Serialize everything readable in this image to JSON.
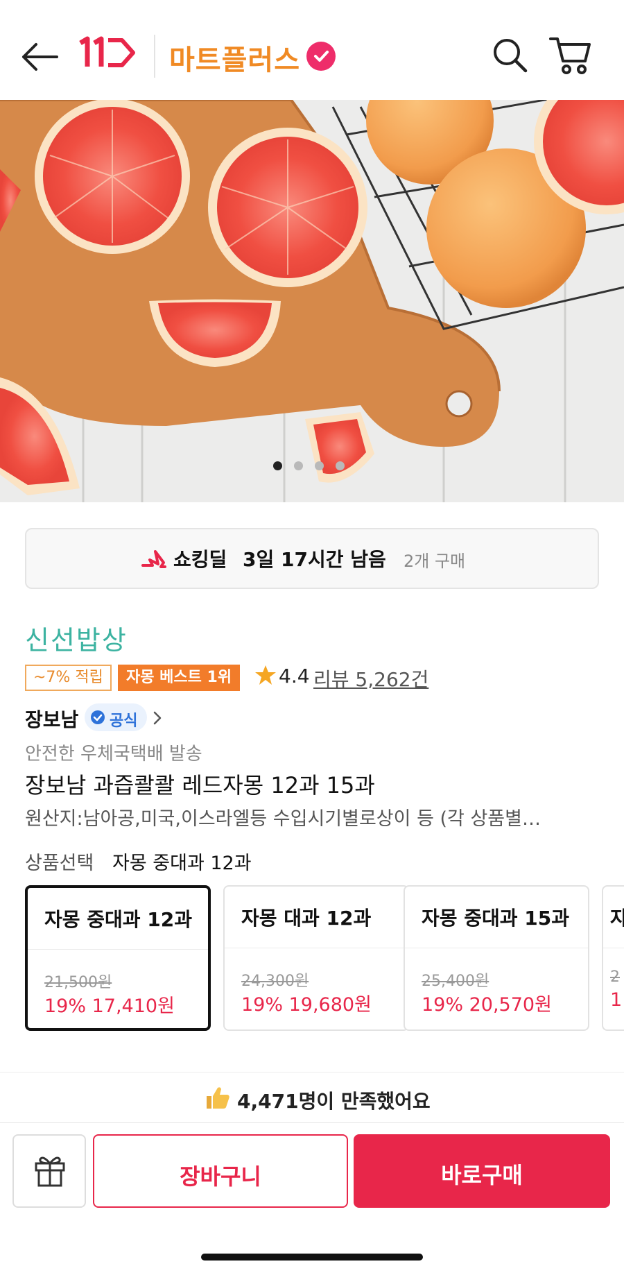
{
  "header": {
    "logo": "11",
    "mart_name": "마트플러스"
  },
  "hero": {
    "image_subject": "red grapefruit halves on wooden cutting board with whole grapefruits in wire basket",
    "slide_count": 4,
    "active_slide": 1
  },
  "deal": {
    "label": "쇼킹딜",
    "time_left": "3일 17시간 남음",
    "purchase_count": "2개 구매"
  },
  "brand_title": "신선밥상",
  "tags": {
    "point": "~7% 적립",
    "best": "자몽 베스트 1위"
  },
  "rating": {
    "score": "4.4",
    "reviews": "리뷰 5,262건"
  },
  "seller": {
    "name": "장보남",
    "official_label": "공식"
  },
  "shipping": "안전한 우체국택배 발송",
  "product_name": "장보남 과즙콸콸 레드자몽 12과 15과",
  "origin": "원산지:남아공,미국,이스라엘등 수입시기별로상이 등 (각 상품별…",
  "option": {
    "label": "상품선택",
    "selected": "자몽 중대과 12과",
    "cards": [
      {
        "name": "자몽 중대과 12과",
        "original": "21,500원",
        "price": "19% 17,410원"
      },
      {
        "name": "자몽 대과 12과",
        "original": "24,300원",
        "price": "19% 19,680원"
      },
      {
        "name": "자몽 중대과 15과",
        "original": "25,400원",
        "price": "19% 20,570원"
      },
      {
        "name": "자",
        "original": "2",
        "price": "1"
      }
    ]
  },
  "satisfaction": "4,471명이 만족했어요",
  "actions": {
    "cart": "장바구니",
    "buy": "바로구매"
  },
  "colors": {
    "accent_red": "#e8264a",
    "brand_orange": "#f08a24",
    "teal": "#3cb3a1"
  }
}
